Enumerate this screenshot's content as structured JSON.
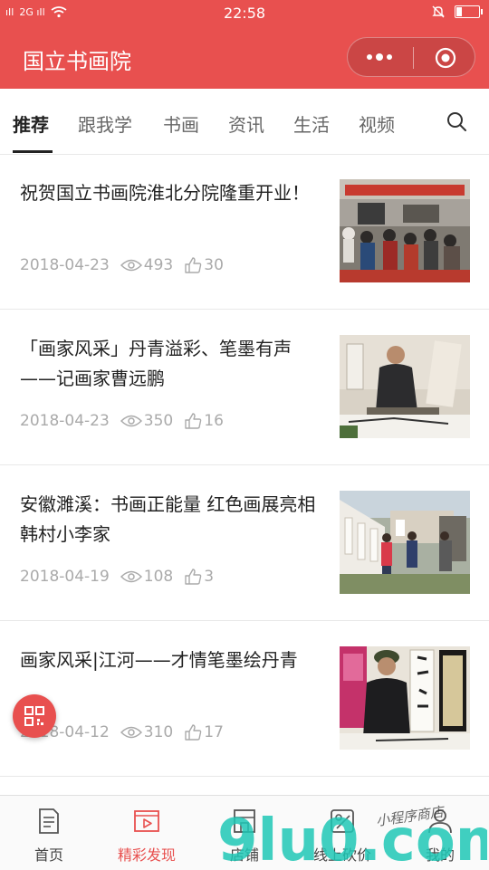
{
  "status_bar": {
    "signal_1": "ıIl",
    "signal_2": "2G ıIl",
    "time": "22:58"
  },
  "header": {
    "title": "国立书画院",
    "more_icon": "more-dots-icon",
    "close_icon": "target-circle-icon"
  },
  "tabs": {
    "items": [
      {
        "label": "推荐",
        "active": true
      },
      {
        "label": "跟我学"
      },
      {
        "label": "书画"
      },
      {
        "label": "资讯"
      },
      {
        "label": "生活"
      },
      {
        "label": "视频"
      }
    ],
    "search_icon": "search-icon"
  },
  "articles": [
    {
      "title": "祝贺国立书画院淮北分院隆重开业！",
      "date": "2018-04-23",
      "views": "493",
      "likes": "30"
    },
    {
      "title": "「画家风采」丹青溢彩、笔墨有声——记画家曹远鹏",
      "date": "2018-04-23",
      "views": "350",
      "likes": "16"
    },
    {
      "title": "安徽濉溪：书画正能量 红色画展亮相韩村小李家",
      "date": "2018-04-19",
      "views": "108",
      "likes": "3"
    },
    {
      "title": "画家风采|江河——才情笔墨绘丹青",
      "date": "2018-04-12",
      "views": "310",
      "likes": "17"
    }
  ],
  "bottom_nav": {
    "items": [
      {
        "label": "首页",
        "icon": "document-icon"
      },
      {
        "label": "精彩发现",
        "icon": "video-icon",
        "active": true
      },
      {
        "label": "店铺",
        "icon": "shop-icon"
      },
      {
        "label": "线上砍价",
        "icon": "tag-icon"
      },
      {
        "label": "我的",
        "icon": "user-icon"
      }
    ]
  },
  "watermark": {
    "logo_text": "9lu0.com",
    "caption": "小程序商店"
  },
  "colors": {
    "brand_red": "#e8504f",
    "text_dark": "#222222",
    "text_meta": "#aaaaaa",
    "divider": "#e8e8e8"
  }
}
